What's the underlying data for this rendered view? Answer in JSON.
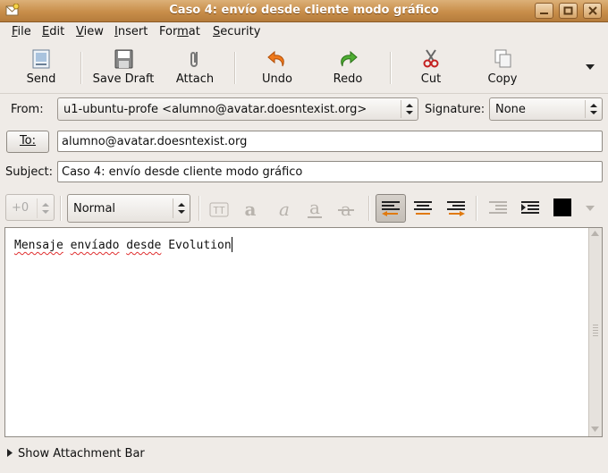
{
  "window": {
    "title": "Caso 4: envío desde cliente modo gráfico"
  },
  "menu": {
    "file": "File",
    "edit": "Edit",
    "view": "View",
    "insert": "Insert",
    "format": "Format",
    "security": "Security"
  },
  "toolbar": {
    "send": "Send",
    "save_draft": "Save Draft",
    "attach": "Attach",
    "undo": "Undo",
    "redo": "Redo",
    "cut": "Cut",
    "copy": "Copy"
  },
  "header": {
    "from_label": "From:",
    "from_value": "u1-ubuntu-profe <alumno@avatar.doesntexist.org>",
    "signature_label": "Signature:",
    "signature_value": "None",
    "to_button": "To:",
    "to_value": "alumno@avatar.doesntexist.org",
    "subject_label": "Subject:",
    "subject_value": "Caso 4: envío desde cliente modo gráfico"
  },
  "format": {
    "font_size": "+0",
    "paragraph_style": "Normal",
    "tt_label": "TT"
  },
  "body": {
    "words": [
      "Mensaje",
      "envíado",
      "desde",
      "Evolution"
    ],
    "misspelled": [
      true,
      true,
      true,
      false
    ]
  },
  "attachment_bar": {
    "label": "Show Attachment Bar"
  },
  "colors": {
    "titlebar": "#c88e4a",
    "text_color_swatch": "#000000",
    "spell_underline": "#e03030"
  }
}
